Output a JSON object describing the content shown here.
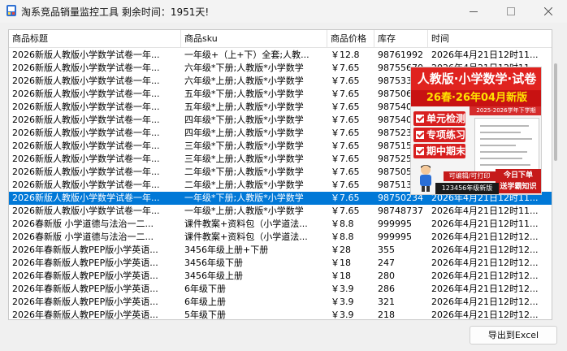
{
  "window": {
    "title": "淘系竞品销量监控工具  剩余时间：1951天!",
    "minimize_icon": "minimize-icon",
    "maximize_icon": "maximize-icon",
    "close_icon": "close-icon",
    "app_icon": "app-logo-icon"
  },
  "table": {
    "headers": [
      "商品标题",
      "商品sku",
      "商品价格",
      "库存",
      "时间"
    ],
    "selected_row": 11,
    "rows": [
      [
        "2026新版人教版小学数学试卷一年...",
        "一年级+（上+下）全套;人教...",
        "￥12.8",
        "98761992",
        "2026年4月21日12时11..."
      ],
      [
        "2026新版人教版小学数学试卷一年...",
        "六年级*下册;人教版*小学数学",
        "￥7.65",
        "98755670",
        "2026年4月21日12时11..."
      ],
      [
        "2026新版人教版小学数学试卷一年...",
        "六年级*上册;人教版*小学数学",
        "￥7.65",
        "98753398",
        "2026年4月21日12时11..."
      ],
      [
        "2026新版人教版小学数学试卷一年...",
        "五年级*下册;人教版*小学数学",
        "￥7.65",
        "98750660",
        "2026年4月21日12时11..."
      ],
      [
        "2026新版人教版小学数学试卷一年...",
        "五年级*上册;人教版*小学数学",
        "￥7.65",
        "98754094",
        "2026年4月21日12时11..."
      ],
      [
        "2026新版人教版小学数学试卷一年...",
        "四年级*下册;人教版*小学数学",
        "￥7.65",
        "98754044",
        "2026年4月21日12时11..."
      ],
      [
        "2026新版人教版小学数学试卷一年...",
        "四年级*上册;人教版*小学数学",
        "￥7.65",
        "98752375",
        "2026年4月21日12时11..."
      ],
      [
        "2026新版人教版小学数学试卷一年...",
        "三年级*下册;人教版*小学数学",
        "￥7.65",
        "98751554",
        "2026年4月21日12时11..."
      ],
      [
        "2026新版人教版小学数学试卷一年...",
        "三年级*上册;人教版*小学数学",
        "￥7.65",
        "98752508",
        "2026年4月21日12时11..."
      ],
      [
        "2026新版人教版小学数学试卷一年...",
        "二年级*下册;人教版*小学数学",
        "￥7.65",
        "98750580",
        "2026年4月21日12时11..."
      ],
      [
        "2026新版人教版小学数学试卷一年...",
        "二年级*上册;人教版*小学数学",
        "￥7.65",
        "98751322",
        "2026年4月21日12时11..."
      ],
      [
        "2026新版人教版小学数学试卷一年...",
        "一年级*下册;人教版*小学数学",
        "￥7.65",
        "98750234",
        "2026年4月21日12时11..."
      ],
      [
        "2026新版人教版小学数学试卷一年...",
        "一年级*上册;人教版*小学数学",
        "￥7.65",
        "98748737",
        "2026年4月21日12时11..."
      ],
      [
        "2026春新版 小学道德与法治一二...",
        "课件教案+资料包（小学道法...",
        "￥8.8",
        "999995",
        "2026年4月21日12时11..."
      ],
      [
        "2026春新版 小学道德与法治一二...",
        "课件教案+资料包（小学道法...",
        "￥8.8",
        "999995",
        "2026年4月21日12时12..."
      ],
      [
        "2026年春新版人教PEP版小学英语...",
        "3456年级上册+下册",
        "￥28",
        "355",
        "2026年4月21日12时12..."
      ],
      [
        "2026年春新版人教PEP版小学英语...",
        "3456年级下册",
        "￥18",
        "247",
        "2026年4月21日12时12..."
      ],
      [
        "2026年春新版人教PEP版小学英语...",
        "3456年级上册",
        "￥18",
        "280",
        "2026年4月21日12时12..."
      ],
      [
        "2026年春新版人教PEP版小学英语...",
        "6年级下册",
        "￥3.9",
        "286",
        "2026年4月21日12时12..."
      ],
      [
        "2026年春新版人教PEP版小学英语...",
        "6年级上册",
        "￥3.9",
        "321",
        "2026年4月21日12时12..."
      ],
      [
        "2026年春新版人教PEP版小学英语...",
        "5年级下册",
        "￥3.9",
        "218",
        "2026年4月21日12时12..."
      ]
    ]
  },
  "preview": {
    "banner_main": "人教版·小学数学·试卷",
    "banner_edition": "26春·26年04月新版",
    "banner_sub": "2025-2026学年下学期",
    "features": [
      "单元检测",
      "专项练习",
      "期中期末"
    ],
    "editable": "可编辑/可打印",
    "today_line1": "今日下单",
    "today_line2": "送学霸知识",
    "grades": "123456年级新版"
  },
  "buttons": {
    "export": "导出到Excel"
  },
  "colors": {
    "selection": "#0078d7",
    "banner_red": "#e0231f",
    "banner_yellow": "#ffe100"
  }
}
